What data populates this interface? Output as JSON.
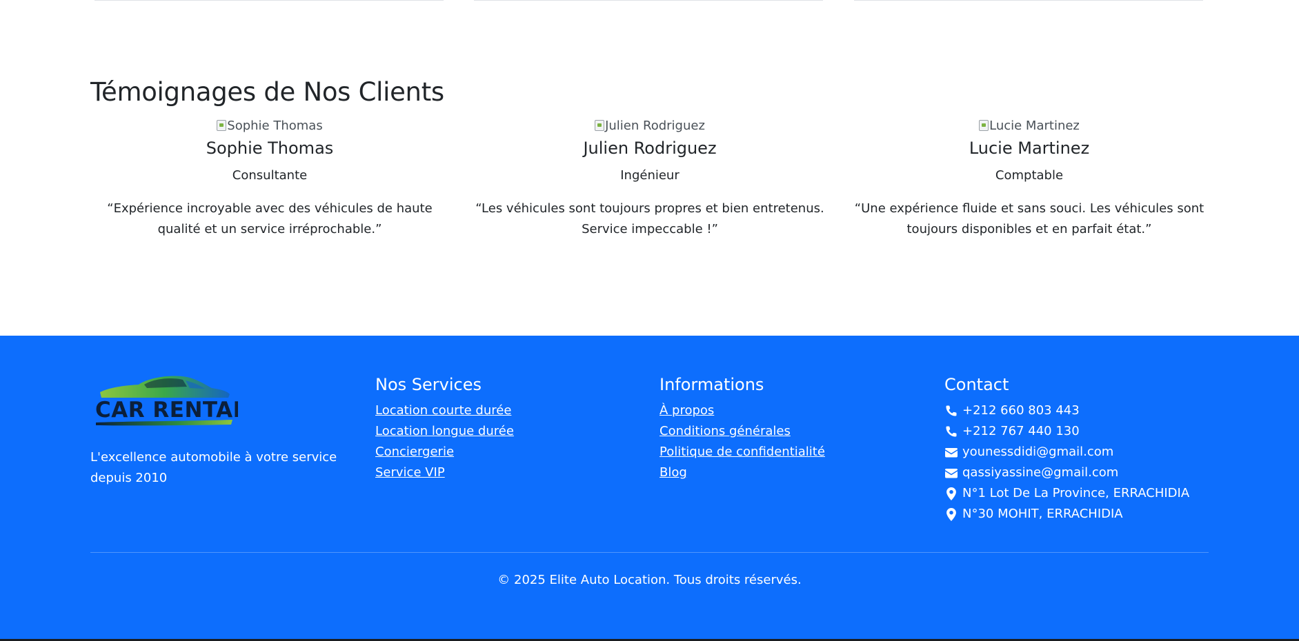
{
  "testimonials": {
    "title": "Témoignages de Nos Clients",
    "items": [
      {
        "image_alt": "Sophie Thomas",
        "name": "Sophie Thomas",
        "role": "Consultante",
        "quote": "“Expérience incroyable avec des véhicules de haute qualité et un service irréprochable.”"
      },
      {
        "image_alt": "Julien Rodriguez",
        "name": "Julien Rodriguez",
        "role": "Ingénieur",
        "quote": "“Les véhicules sont toujours propres et bien entretenus. Service impeccable !”"
      },
      {
        "image_alt": "Lucie Martinez",
        "name": "Lucie Martinez",
        "role": "Comptable",
        "quote": "“Une expérience fluide et sans souci. Les véhicules sont toujours disponibles et en parfait état.”"
      }
    ]
  },
  "footer": {
    "logo_text": "CAR RENTAL",
    "tagline": "L'excellence automobile à votre service depuis 2010",
    "services": {
      "heading": "Nos Services",
      "links": [
        "Location courte durée",
        "Location longue durée",
        "Conciergerie",
        "Service VIP"
      ]
    },
    "info": {
      "heading": "Informations",
      "links": [
        "À propos",
        "Conditions générales",
        "Politique de confidentialité",
        "Blog"
      ]
    },
    "contact": {
      "heading": "Contact",
      "items": [
        {
          "icon": "phone-icon",
          "text": "+212 660 803 443"
        },
        {
          "icon": "phone-icon",
          "text": "+212 767 440 130"
        },
        {
          "icon": "envelope-icon",
          "text": "younessdidi@gmail.com"
        },
        {
          "icon": "envelope-icon",
          "text": "qassiyassine@gmail.com"
        },
        {
          "icon": "map-marker-icon",
          "text": "N°1 Lot De La Province, ERRACHIDIA"
        },
        {
          "icon": "map-marker-icon",
          "text": "N°30 MOHIT, ERRACHIDIA"
        }
      ]
    },
    "copyright": "© 2025 Elite Auto Location. Tous droits réservés."
  },
  "colors": {
    "footer_bg": "#0d6efd",
    "text_dark": "#212529",
    "text_light": "#ffffff",
    "logo_green": "#7cc242",
    "logo_navy": "#0b1f3a"
  }
}
